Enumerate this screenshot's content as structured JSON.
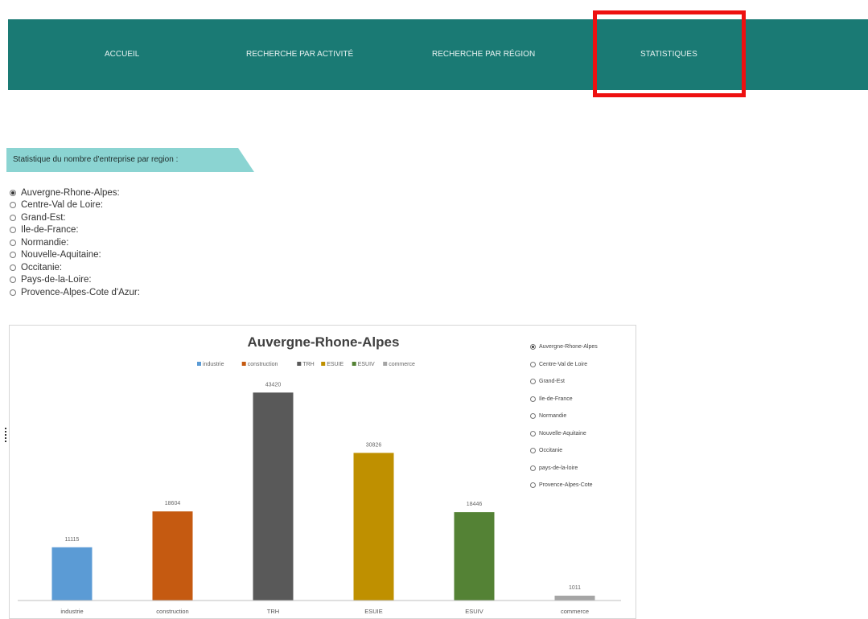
{
  "nav": {
    "items": [
      {
        "label": "ACCUEIL"
      },
      {
        "label": "RECHERCHE PAR ACTIVITÉ"
      },
      {
        "label": "RECHERCHE PAR RÉGION"
      },
      {
        "label": "STATISTIQUES"
      }
    ],
    "highlighted": "STATISTIQUES",
    "background_color": "#1a7a74",
    "highlight_color": "#ee1111"
  },
  "section": {
    "title": "Statistique du nombre d'entreprise par region :",
    "banner_color": "#8bd4d2"
  },
  "regions": {
    "selected": "Auvergne-Rhone-Alpes:",
    "options": [
      {
        "label": "Auvergne-Rhone-Alpes:",
        "checked": true
      },
      {
        "label": "Centre-Val de Loire:",
        "checked": false
      },
      {
        "label": "Grand-Est:",
        "checked": false
      },
      {
        "label": "Ile-de-France:",
        "checked": false
      },
      {
        "label": "Normandie:",
        "checked": false
      },
      {
        "label": "Nouvelle-Aquitaine:",
        "checked": false
      },
      {
        "label": "Occitanie:",
        "checked": false
      },
      {
        "label": "Pays-de-la-Loire:",
        "checked": false
      },
      {
        "label": "Provence-Alpes-Cote d'Azur:",
        "checked": false
      }
    ]
  },
  "chart_side_list": {
    "options": [
      {
        "label": "Auvergne-Rhone-Alpes",
        "checked": true
      },
      {
        "label": "Centre-Val de Loire",
        "checked": false
      },
      {
        "label": "Grand-Est",
        "checked": false
      },
      {
        "label": "Ile-de-France",
        "checked": false
      },
      {
        "label": "Normandie",
        "checked": false
      },
      {
        "label": "Nouvelle-Aquitaine",
        "checked": false
      },
      {
        "label": "Occitanie",
        "checked": false
      },
      {
        "label": "pays-de-la-loire",
        "checked": false
      },
      {
        "label": "Provence-Alpes-Cote",
        "checked": false
      }
    ]
  },
  "chart_data": {
    "type": "bar",
    "title": "Auvergne-Rhone-Alpes",
    "xlabel": "",
    "ylabel": "",
    "categories": [
      "industrie",
      "construction",
      "TRH",
      "ESUIE",
      "ESUIV",
      "commerce"
    ],
    "values": [
      11115,
      18604,
      43420,
      30826,
      18446,
      1011
    ],
    "value_labels": [
      "11115",
      "18604",
      "43420",
      "30826",
      "18446",
      "1011"
    ],
    "colors": [
      "#5b9bd5",
      "#c55a11",
      "#595959",
      "#bf9000",
      "#548235",
      "#a5a5a5"
    ],
    "legend": [
      "industrie",
      "construction",
      "TRH",
      "ESUIE",
      "ESUIV",
      "commerce"
    ],
    "legend_position": "top",
    "ylim": [
      0,
      47000
    ],
    "grid": false
  }
}
